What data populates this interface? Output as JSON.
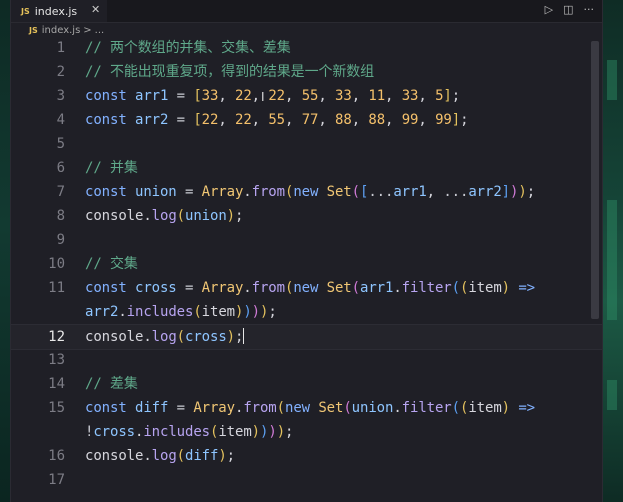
{
  "tab": {
    "file_badge": "JS",
    "file_name": "index.js",
    "close_glyph": "✕"
  },
  "toolbar": {
    "run_icon": "▷",
    "split_icon": "◫",
    "more_icon": "···"
  },
  "breadcrumb": {
    "file_badge": "JS",
    "file_name": "index.js",
    "separator": ">",
    "ellipsis": "..."
  },
  "active_line": 12,
  "lines": [
    {
      "n": "1",
      "tokens": [
        {
          "t": "// 两个数组的并集、交集、差集",
          "c": "comment"
        }
      ]
    },
    {
      "n": "2",
      "tokens": [
        {
          "t": "// 不能出现重复项，得到的结果是一个新数组",
          "c": "comment"
        }
      ]
    },
    {
      "n": "3",
      "tokens": [
        {
          "t": "const ",
          "c": "keyword"
        },
        {
          "t": "arr1",
          "c": "ident"
        },
        {
          "t": " = ",
          "c": "op"
        },
        {
          "t": "[",
          "c": "b1"
        },
        {
          "t": "33",
          "c": "num"
        },
        {
          "t": ", ",
          "c": "punct"
        },
        {
          "t": "22",
          "c": "num"
        },
        {
          "t": ", ",
          "c": "punct"
        },
        {
          "t": "22",
          "c": "num"
        },
        {
          "t": ", ",
          "c": "punct"
        },
        {
          "t": "55",
          "c": "num"
        },
        {
          "t": ", ",
          "c": "punct"
        },
        {
          "t": "33",
          "c": "num"
        },
        {
          "t": ", ",
          "c": "punct"
        },
        {
          "t": "11",
          "c": "num"
        },
        {
          "t": ", ",
          "c": "punct"
        },
        {
          "t": "33",
          "c": "num"
        },
        {
          "t": ", ",
          "c": "punct"
        },
        {
          "t": "5",
          "c": "num"
        },
        {
          "t": "]",
          "c": "b1"
        },
        {
          "t": ";",
          "c": "punct"
        }
      ]
    },
    {
      "n": "4",
      "tokens": [
        {
          "t": "const ",
          "c": "keyword"
        },
        {
          "t": "arr2",
          "c": "ident"
        },
        {
          "t": " = ",
          "c": "op"
        },
        {
          "t": "[",
          "c": "b1"
        },
        {
          "t": "22",
          "c": "num"
        },
        {
          "t": ", ",
          "c": "punct"
        },
        {
          "t": "22",
          "c": "num"
        },
        {
          "t": ", ",
          "c": "punct"
        },
        {
          "t": "55",
          "c": "num"
        },
        {
          "t": ", ",
          "c": "punct"
        },
        {
          "t": "77",
          "c": "num"
        },
        {
          "t": ", ",
          "c": "punct"
        },
        {
          "t": "88",
          "c": "num"
        },
        {
          "t": ", ",
          "c": "punct"
        },
        {
          "t": "88",
          "c": "num"
        },
        {
          "t": ", ",
          "c": "punct"
        },
        {
          "t": "99",
          "c": "num"
        },
        {
          "t": ", ",
          "c": "punct"
        },
        {
          "t": "99",
          "c": "num"
        },
        {
          "t": "]",
          "c": "b1"
        },
        {
          "t": ";",
          "c": "punct"
        }
      ]
    },
    {
      "n": "5",
      "tokens": []
    },
    {
      "n": "6",
      "tokens": [
        {
          "t": "// 并集",
          "c": "comment"
        }
      ]
    },
    {
      "n": "7",
      "tokens": [
        {
          "t": "const ",
          "c": "keyword"
        },
        {
          "t": "union",
          "c": "ident"
        },
        {
          "t": " = ",
          "c": "op"
        },
        {
          "t": "Array",
          "c": "class"
        },
        {
          "t": ".",
          "c": "punct"
        },
        {
          "t": "from",
          "c": "fn"
        },
        {
          "t": "(",
          "c": "b1"
        },
        {
          "t": "new ",
          "c": "keyword"
        },
        {
          "t": "Set",
          "c": "class"
        },
        {
          "t": "(",
          "c": "b2"
        },
        {
          "t": "[",
          "c": "b3"
        },
        {
          "t": "...",
          "c": "op"
        },
        {
          "t": "arr1",
          "c": "ident"
        },
        {
          "t": ", ",
          "c": "punct"
        },
        {
          "t": "...",
          "c": "op"
        },
        {
          "t": "arr2",
          "c": "ident"
        },
        {
          "t": "]",
          "c": "b3"
        },
        {
          "t": ")",
          "c": "b2"
        },
        {
          "t": ")",
          "c": "b1"
        },
        {
          "t": ";",
          "c": "punct"
        }
      ]
    },
    {
      "n": "8",
      "tokens": [
        {
          "t": "console",
          "c": "obj"
        },
        {
          "t": ".",
          "c": "punct"
        },
        {
          "t": "log",
          "c": "fn"
        },
        {
          "t": "(",
          "c": "b1"
        },
        {
          "t": "union",
          "c": "ident"
        },
        {
          "t": ")",
          "c": "b1"
        },
        {
          "t": ";",
          "c": "punct"
        }
      ]
    },
    {
      "n": "9",
      "tokens": []
    },
    {
      "n": "10",
      "tokens": [
        {
          "t": "// 交集",
          "c": "comment"
        }
      ]
    },
    {
      "n": "11",
      "tokens": [
        {
          "t": "const ",
          "c": "keyword"
        },
        {
          "t": "cross",
          "c": "ident"
        },
        {
          "t": " = ",
          "c": "op"
        },
        {
          "t": "Array",
          "c": "class"
        },
        {
          "t": ".",
          "c": "punct"
        },
        {
          "t": "from",
          "c": "fn"
        },
        {
          "t": "(",
          "c": "b1"
        },
        {
          "t": "new ",
          "c": "keyword"
        },
        {
          "t": "Set",
          "c": "class"
        },
        {
          "t": "(",
          "c": "b2"
        },
        {
          "t": "arr1",
          "c": "ident"
        },
        {
          "t": ".",
          "c": "punct"
        },
        {
          "t": "filter",
          "c": "fn"
        },
        {
          "t": "(",
          "c": "b3"
        },
        {
          "t": "(",
          "c": "b1"
        },
        {
          "t": "item",
          "c": "param"
        },
        {
          "t": ")",
          "c": "b1"
        },
        {
          "t": " =>",
          "c": "keyword"
        }
      ]
    },
    {
      "n": "",
      "tokens": [
        {
          "t": "arr2",
          "c": "ident"
        },
        {
          "t": ".",
          "c": "punct"
        },
        {
          "t": "includes",
          "c": "fn"
        },
        {
          "t": "(",
          "c": "b1"
        },
        {
          "t": "item",
          "c": "param"
        },
        {
          "t": ")",
          "c": "b1"
        },
        {
          "t": ")",
          "c": "b3"
        },
        {
          "t": ")",
          "c": "b2"
        },
        {
          "t": ")",
          "c": "b1"
        },
        {
          "t": ";",
          "c": "punct"
        }
      ]
    },
    {
      "n": "12",
      "tokens": [
        {
          "t": "console",
          "c": "obj"
        },
        {
          "t": ".",
          "c": "punct"
        },
        {
          "t": "log",
          "c": "fn"
        },
        {
          "t": "(",
          "c": "b1"
        },
        {
          "t": "cross",
          "c": "ident"
        },
        {
          "t": ")",
          "c": "b1"
        },
        {
          "t": ";",
          "c": "punct"
        }
      ],
      "caret": true
    },
    {
      "n": "13",
      "tokens": []
    },
    {
      "n": "14",
      "tokens": [
        {
          "t": "// 差集",
          "c": "comment"
        }
      ]
    },
    {
      "n": "15",
      "tokens": [
        {
          "t": "const ",
          "c": "keyword"
        },
        {
          "t": "diff",
          "c": "ident"
        },
        {
          "t": " = ",
          "c": "op"
        },
        {
          "t": "Array",
          "c": "class"
        },
        {
          "t": ".",
          "c": "punct"
        },
        {
          "t": "from",
          "c": "fn"
        },
        {
          "t": "(",
          "c": "b1"
        },
        {
          "t": "new ",
          "c": "keyword"
        },
        {
          "t": "Set",
          "c": "class"
        },
        {
          "t": "(",
          "c": "b2"
        },
        {
          "t": "union",
          "c": "ident"
        },
        {
          "t": ".",
          "c": "punct"
        },
        {
          "t": "filter",
          "c": "fn"
        },
        {
          "t": "(",
          "c": "b3"
        },
        {
          "t": "(",
          "c": "b1"
        },
        {
          "t": "item",
          "c": "param"
        },
        {
          "t": ")",
          "c": "b1"
        },
        {
          "t": " =>",
          "c": "keyword"
        }
      ]
    },
    {
      "n": "",
      "tokens": [
        {
          "t": "!",
          "c": "op"
        },
        {
          "t": "cross",
          "c": "ident"
        },
        {
          "t": ".",
          "c": "punct"
        },
        {
          "t": "includes",
          "c": "fn"
        },
        {
          "t": "(",
          "c": "b1"
        },
        {
          "t": "item",
          "c": "param"
        },
        {
          "t": ")",
          "c": "b1"
        },
        {
          "t": ")",
          "c": "b3"
        },
        {
          "t": ")",
          "c": "b2"
        },
        {
          "t": ")",
          "c": "b1"
        },
        {
          "t": ";",
          "c": "punct"
        }
      ]
    },
    {
      "n": "16",
      "tokens": [
        {
          "t": "console",
          "c": "obj"
        },
        {
          "t": ".",
          "c": "punct"
        },
        {
          "t": "log",
          "c": "fn"
        },
        {
          "t": "(",
          "c": "b1"
        },
        {
          "t": "diff",
          "c": "ident"
        },
        {
          "t": ")",
          "c": "b1"
        },
        {
          "t": ";",
          "c": "punct"
        }
      ]
    },
    {
      "n": "17",
      "tokens": []
    }
  ]
}
